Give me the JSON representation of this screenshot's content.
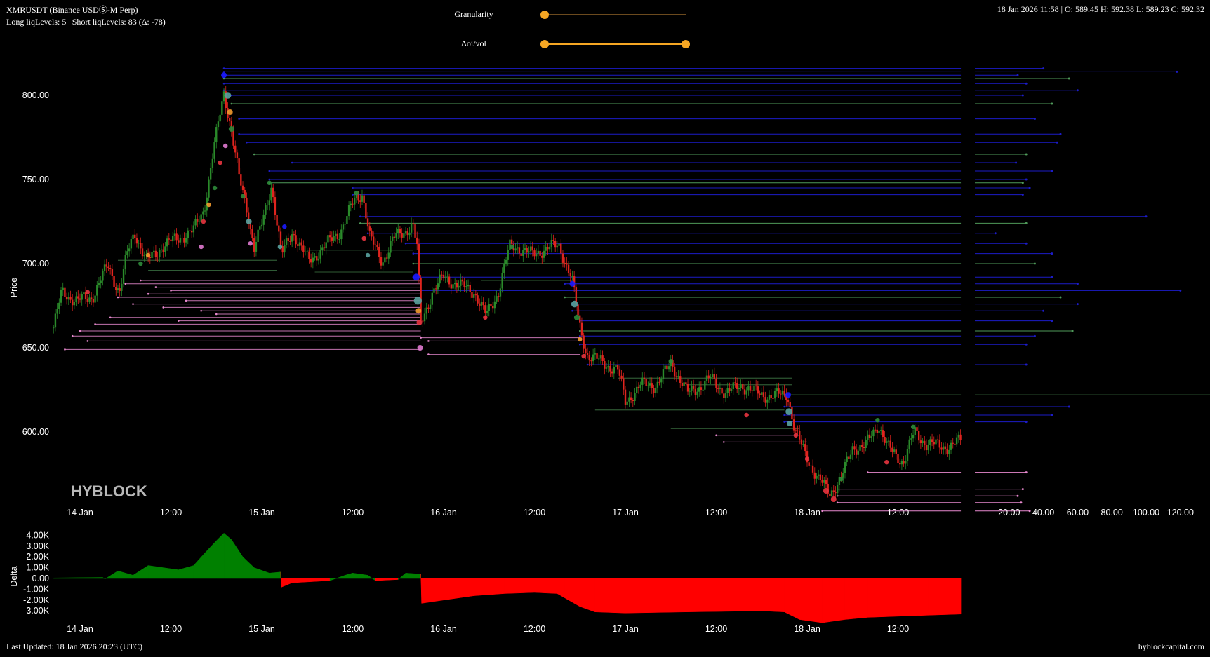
{
  "header": {
    "title": "XMRUSDT (Binance USDⓈ-M Perp)",
    "liq_summary": "Long liqLevels: 5 | Short liqLevels: 83 (Δ: -78)",
    "ohlc": "18 Jan 2026 11:58 | O: 589.45 H: 592.38 L: 589.23 C: 592.32"
  },
  "controls": {
    "granularity_label": "Granularity",
    "granularity_value": 0,
    "oi_vol_label": "Δoi/vol",
    "oi_vol_range": [
      0,
      1
    ]
  },
  "watermark": "HYBLOCK",
  "footer": {
    "last_updated": "Last Updated: 18 Jan 2026 20:23 (UTC)",
    "site": "hyblockcapital.com"
  },
  "colors": {
    "up": "#2a8a2a",
    "down": "#e0241e",
    "short_level": "#1c1cc8",
    "long_level": "#e889cf",
    "mid_level": "#4f9a5a",
    "delta_pos": "#008000",
    "delta_neg": "#ff0000",
    "slider": "#f5a623",
    "slider_track_dim": "#6b4a1e"
  },
  "chart_data": [
    {
      "type": "line",
      "name": "price",
      "ylabel": "Price",
      "yticks": [
        "600.00",
        "650.00",
        "700.00",
        "750.00",
        "800.00"
      ],
      "ytick_values": [
        600,
        650,
        700,
        750,
        800
      ],
      "ylim": [
        554,
        818
      ],
      "xlim_hours": [
        -3.5,
        116.3
      ],
      "xticks": [
        {
          "label": "14 Jan",
          "h": 0
        },
        {
          "label": "12:00",
          "h": 12
        },
        {
          "label": "15 Jan",
          "h": 24
        },
        {
          "label": "12:00",
          "h": 36
        },
        {
          "label": "16 Jan",
          "h": 48
        },
        {
          "label": "12:00",
          "h": 60
        },
        {
          "label": "17 Jan",
          "h": 72
        },
        {
          "label": "12:00",
          "h": 84
        },
        {
          "label": "18 Jan",
          "h": 96
        },
        {
          "label": "12:00",
          "h": 108
        }
      ],
      "price_path": [
        [
          -3.5,
          662
        ],
        [
          -2.4,
          683
        ],
        [
          -0.4,
          678
        ],
        [
          1.6,
          680
        ],
        [
          3.7,
          699
        ],
        [
          5.2,
          683
        ],
        [
          6.2,
          705
        ],
        [
          7.2,
          719
        ],
        [
          8.8,
          701
        ],
        [
          10.8,
          710
        ],
        [
          12.8,
          715
        ],
        [
          14.9,
          719
        ],
        [
          16.4,
          733
        ],
        [
          17.9,
          774
        ],
        [
          19.0,
          802
        ],
        [
          20.0,
          779
        ],
        [
          21.0,
          751
        ],
        [
          22.0,
          733
        ],
        [
          23.0,
          710
        ],
        [
          24.1,
          724
        ],
        [
          25.3,
          747
        ],
        [
          26.6,
          705
        ],
        [
          28.1,
          719
        ],
        [
          30.2,
          701
        ],
        [
          32.2,
          710
        ],
        [
          34.3,
          719
        ],
        [
          36.3,
          738
        ],
        [
          37.3,
          742
        ],
        [
          38.3,
          715
        ],
        [
          39.9,
          701
        ],
        [
          41.4,
          715
        ],
        [
          42.9,
          719
        ],
        [
          43.9,
          724
        ],
        [
          44.5,
          710
        ],
        [
          45.0,
          664
        ],
        [
          46.5,
          683
        ],
        [
          48.0,
          692
        ],
        [
          50.1,
          687
        ],
        [
          52.1,
          683
        ],
        [
          53.6,
          669
        ],
        [
          55.2,
          683
        ],
        [
          56.7,
          710
        ],
        [
          57.7,
          710
        ],
        [
          59.8,
          705
        ],
        [
          61.8,
          710
        ],
        [
          63.3,
          710
        ],
        [
          64.9,
          692
        ],
        [
          65.9,
          664
        ],
        [
          66.9,
          646
        ],
        [
          69.0,
          641
        ],
        [
          71.0,
          637
        ],
        [
          72.0,
          618
        ],
        [
          74.1,
          628
        ],
        [
          76.1,
          628
        ],
        [
          78.1,
          641
        ],
        [
          80.2,
          623
        ],
        [
          82.2,
          628
        ],
        [
          83.2,
          632
        ],
        [
          85.3,
          623
        ],
        [
          87.3,
          628
        ],
        [
          89.3,
          623
        ],
        [
          91.4,
          621
        ],
        [
          93.4,
          623
        ],
        [
          94.4,
          600
        ],
        [
          95.9,
          586
        ],
        [
          97.4,
          572
        ],
        [
          99.0,
          564
        ],
        [
          100.5,
          572
        ],
        [
          102.0,
          591
        ],
        [
          103.6,
          591
        ],
        [
          105.4,
          605
        ],
        [
          106.6,
          591
        ],
        [
          108.7,
          582
        ],
        [
          110.2,
          600
        ],
        [
          111.7,
          593
        ],
        [
          114.8,
          591
        ],
        [
          116.3,
          595
        ]
      ],
      "short_levels": [
        [
          816,
          19,
          40
        ],
        [
          814,
          19,
          118
        ],
        [
          812,
          19,
          25
        ],
        [
          810,
          19,
          55
        ],
        [
          807,
          19,
          30
        ],
        [
          803,
          19,
          60
        ],
        [
          800,
          20,
          28
        ],
        [
          795,
          20,
          45
        ],
        [
          786,
          21,
          35
        ],
        [
          777,
          21,
          50
        ],
        [
          772,
          22,
          48
        ],
        [
          765,
          23,
          30
        ],
        [
          760,
          28,
          24
        ],
        [
          755,
          25,
          45
        ],
        [
          750,
          25,
          30
        ],
        [
          748,
          25,
          28
        ],
        [
          745,
          36,
          32
        ],
        [
          741,
          36,
          28
        ],
        [
          728,
          37,
          100
        ],
        [
          724,
          37,
          30
        ],
        [
          718,
          38,
          12
        ],
        [
          712,
          43,
          30
        ],
        [
          706,
          44,
          45
        ],
        [
          700,
          44,
          35
        ],
        [
          692,
          44,
          45
        ],
        [
          688,
          64,
          60
        ],
        [
          684,
          45,
          120
        ],
        [
          680,
          64,
          50
        ],
        [
          676,
          65,
          60
        ],
        [
          672,
          65,
          40
        ],
        [
          666,
          66,
          45
        ],
        [
          660,
          66,
          57
        ],
        [
          657,
          66,
          35
        ],
        [
          652,
          66,
          30
        ],
        [
          640,
          67,
          30
        ],
        [
          622,
          93,
          140
        ],
        [
          615,
          93,
          55
        ],
        [
          610,
          93,
          45
        ],
        [
          606,
          93,
          30
        ]
      ],
      "long_levels": [
        [
          576,
          104,
          30
        ],
        [
          566,
          100,
          28
        ],
        [
          562,
          100,
          25
        ],
        [
          558,
          100,
          27
        ],
        [
          553,
          98,
          32
        ]
      ],
      "triggered_long_levels": [
        [
          690,
          8,
          45
        ],
        [
          688,
          6,
          45
        ],
        [
          686,
          10,
          45
        ],
        [
          684,
          12,
          45
        ],
        [
          682,
          9,
          45
        ],
        [
          680,
          5,
          45
        ],
        [
          678,
          14,
          45
        ],
        [
          676,
          7,
          45
        ],
        [
          674,
          11,
          45
        ],
        [
          672,
          16,
          45
        ],
        [
          670,
          18,
          45
        ],
        [
          668,
          4,
          45
        ],
        [
          666,
          13,
          45
        ],
        [
          664,
          2,
          45
        ],
        [
          660,
          0,
          45
        ],
        [
          657,
          -1,
          45
        ],
        [
          654,
          1,
          45
        ],
        [
          649,
          -2,
          45
        ],
        [
          656,
          45,
          66
        ],
        [
          654,
          46,
          66
        ],
        [
          646,
          46,
          66
        ],
        [
          598,
          84,
          95
        ],
        [
          594,
          85,
          96
        ]
      ],
      "triggered_mid_levels": [
        [
          702,
          5,
          26
        ],
        [
          696,
          9,
          26
        ],
        [
          708,
          30,
          44
        ],
        [
          695,
          31,
          44
        ],
        [
          690,
          53,
          65
        ],
        [
          632,
          71,
          94
        ],
        [
          628,
          80,
          94
        ],
        [
          613,
          68,
          93
        ],
        [
          602,
          78,
          95
        ]
      ],
      "markers": [
        [
          19,
          812,
          "#1a1aff",
          5
        ],
        [
          19.5,
          800,
          "#5aa3a0",
          6
        ],
        [
          19.8,
          790,
          "#f29a2e",
          5
        ],
        [
          20,
          780,
          "#2e8b3a",
          5
        ],
        [
          19.2,
          770,
          "#e07ad0",
          4
        ],
        [
          18.5,
          760,
          "#e8343f",
          4
        ],
        [
          17.8,
          745,
          "#2e8b3a",
          4
        ],
        [
          17,
          735,
          "#f29a2e",
          4
        ],
        [
          16.3,
          725,
          "#e8343f",
          4
        ],
        [
          16,
          710,
          "#e07ad0",
          4
        ],
        [
          21.5,
          740,
          "#2e8b3a",
          4
        ],
        [
          22.3,
          725,
          "#5aa3a0",
          5
        ],
        [
          22.5,
          712,
          "#e07ad0",
          4
        ],
        [
          25,
          748,
          "#2e8b3a",
          4
        ],
        [
          26.4,
          710,
          "#5aa3a0",
          4
        ],
        [
          27,
          722,
          "#1a1aff",
          4
        ],
        [
          36.5,
          742,
          "#2e8b3a",
          4
        ],
        [
          37.5,
          715,
          "#e8343f",
          4
        ],
        [
          38,
          705,
          "#5aa3a0",
          4
        ],
        [
          44.4,
          692,
          "#1a1aff",
          6
        ],
        [
          44.6,
          678,
          "#5aa3a0",
          7
        ],
        [
          44.7,
          672,
          "#f29a2e",
          5
        ],
        [
          44.8,
          665,
          "#e8343f",
          5
        ],
        [
          44.9,
          650,
          "#e07ad0",
          5
        ],
        [
          8,
          700,
          "#2e8b3a",
          4
        ],
        [
          9,
          705,
          "#f29a2e",
          4
        ],
        [
          1,
          683,
          "#e8343f",
          4
        ],
        [
          57,
          710,
          "#2e8b3a",
          4
        ],
        [
          53.5,
          668,
          "#e8343f",
          4
        ],
        [
          65,
          688,
          "#1a1aff",
          5
        ],
        [
          65.3,
          676,
          "#5aa3a0",
          6
        ],
        [
          65.6,
          668,
          "#2e8b3a",
          5
        ],
        [
          66,
          655,
          "#f29a2e",
          4
        ],
        [
          66.5,
          645,
          "#e8343f",
          4
        ],
        [
          78,
          642,
          "#2e8b3a",
          4
        ],
        [
          93.5,
          622,
          "#1a1aff",
          5
        ],
        [
          93.6,
          612,
          "#5aa3a0",
          6
        ],
        [
          93.7,
          605,
          "#5aa3a0",
          5
        ],
        [
          94.5,
          598,
          "#e8343f",
          4
        ],
        [
          96,
          584,
          "#e8343f",
          4
        ],
        [
          98.5,
          565,
          "#e8343f",
          5
        ],
        [
          99.5,
          560,
          "#e8343f",
          5
        ],
        [
          100.5,
          572,
          "#2e8b3a",
          4
        ],
        [
          105.3,
          607,
          "#2e8b3a",
          4
        ],
        [
          106.5,
          582,
          "#e8343f",
          4
        ],
        [
          110,
          603,
          "#2e8b3a",
          4
        ],
        [
          88,
          610,
          "#e8343f",
          4
        ]
      ]
    },
    {
      "type": "bar",
      "name": "liquidation-size-histogram",
      "xticks": [
        "20.00",
        "40.00",
        "60.00",
        "80.00",
        "100.00",
        "120.00"
      ],
      "xtick_values": [
        20,
        40,
        60,
        80,
        100,
        120
      ],
      "xlim": [
        0,
        130
      ]
    },
    {
      "type": "area",
      "name": "delta",
      "ylabel": "Delta",
      "yticks": [
        "4.00K",
        "3.00K",
        "2.00K",
        "1.00K",
        "0.00",
        "-1.00K",
        "-2.00K",
        "-3.00K"
      ],
      "ytick_values": [
        4,
        3,
        2,
        1,
        0,
        -1,
        -2,
        -3
      ],
      "units": "K",
      "series": [
        [
          -3.5,
          0.05
        ],
        [
          3,
          0.1
        ],
        [
          3.3,
          -0.05
        ],
        [
          5,
          0.7
        ],
        [
          7,
          0.3
        ],
        [
          9,
          1.2
        ],
        [
          11,
          1.0
        ],
        [
          13,
          0.8
        ],
        [
          15,
          1.2
        ],
        [
          16.4,
          2.3
        ],
        [
          18,
          3.5
        ],
        [
          19,
          4.2
        ],
        [
          20,
          3.6
        ],
        [
          21.5,
          2.0
        ],
        [
          23,
          1.0
        ],
        [
          25,
          0.5
        ],
        [
          26.5,
          0.6
        ],
        [
          26.6,
          -0.8
        ],
        [
          28,
          -0.4
        ],
        [
          33,
          -0.2
        ],
        [
          35,
          0.3
        ],
        [
          36,
          0.5
        ],
        [
          38,
          0.3
        ],
        [
          39,
          -0.2
        ],
        [
          42,
          -0.1
        ],
        [
          43,
          0.5
        ],
        [
          45,
          0.4
        ],
        [
          45.1,
          -2.3
        ],
        [
          48,
          -2.0
        ],
        [
          52,
          -1.6
        ],
        [
          56,
          -1.4
        ],
        [
          60,
          -1.3
        ],
        [
          63,
          -1.4
        ],
        [
          64,
          -1.8
        ],
        [
          66,
          -2.6
        ],
        [
          68,
          -3.1
        ],
        [
          72,
          -3.2
        ],
        [
          80,
          -3.1
        ],
        [
          90,
          -3.0
        ],
        [
          93,
          -3.1
        ],
        [
          95,
          -3.8
        ],
        [
          98,
          -4.1
        ],
        [
          101,
          -3.8
        ],
        [
          104,
          -3.6
        ],
        [
          108,
          -3.5
        ],
        [
          112,
          -3.4
        ],
        [
          116.3,
          -3.3
        ]
      ]
    }
  ]
}
